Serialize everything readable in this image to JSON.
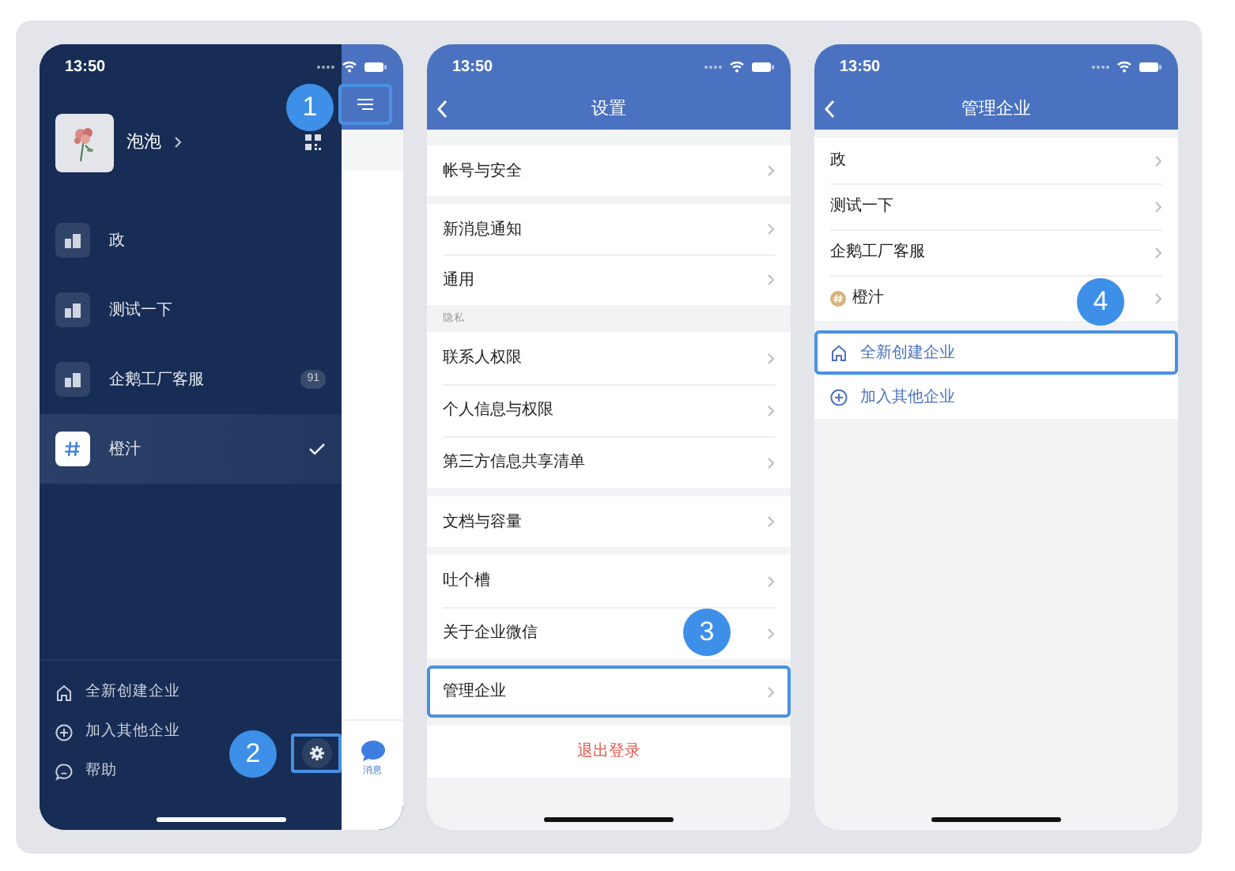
{
  "drawer_screen": {
    "status_time": "13:50",
    "user_name": "泡泡",
    "menu_step": "1",
    "companies": [
      {
        "name": "政",
        "kind": "building",
        "selected": false
      },
      {
        "name": "测试一下",
        "kind": "building",
        "selected": false
      },
      {
        "name": "企鹅工厂客服",
        "kind": "building",
        "badge": "91",
        "selected": false
      },
      {
        "name": "橙汁",
        "kind": "hash",
        "selected": true
      }
    ],
    "actions": [
      {
        "kind": "home",
        "label": "全新创建企业"
      },
      {
        "kind": "plus",
        "label": "加入其他企业"
      },
      {
        "kind": "chat",
        "label": "帮助"
      }
    ],
    "settings_step": "2",
    "tab_label": "消息"
  },
  "settings_screen": {
    "status_time": "13:50",
    "title": "设置",
    "groups": [
      {
        "rows": [
          {
            "label": "帐号与安全"
          }
        ]
      },
      {
        "rows": [
          {
            "label": "新消息通知"
          },
          {
            "label": "通用"
          }
        ]
      },
      {
        "section_label": "隐私",
        "rows": [
          {
            "label": "联系人权限"
          },
          {
            "label": "个人信息与权限"
          },
          {
            "label": "第三方信息共享清单"
          }
        ]
      },
      {
        "rows": [
          {
            "label": "文档与容量"
          }
        ]
      },
      {
        "rows": [
          {
            "label": "吐个槽"
          },
          {
            "label": "关于企业微信"
          }
        ]
      },
      {
        "rows": [
          {
            "label": "管理企业",
            "step": "3"
          }
        ]
      }
    ],
    "logout": "退出登录"
  },
  "manage_screen": {
    "status_time": "13:50",
    "title": "管理企业",
    "companies": [
      {
        "name": "政"
      },
      {
        "name": "测试一下"
      },
      {
        "name": "企鹅工厂客服"
      },
      {
        "name": "橙汁",
        "kind": "hash"
      }
    ],
    "actions": [
      {
        "kind": "home",
        "label": "全新创建企业",
        "step": "4"
      },
      {
        "kind": "plus",
        "label": "加入其他企业"
      }
    ]
  }
}
